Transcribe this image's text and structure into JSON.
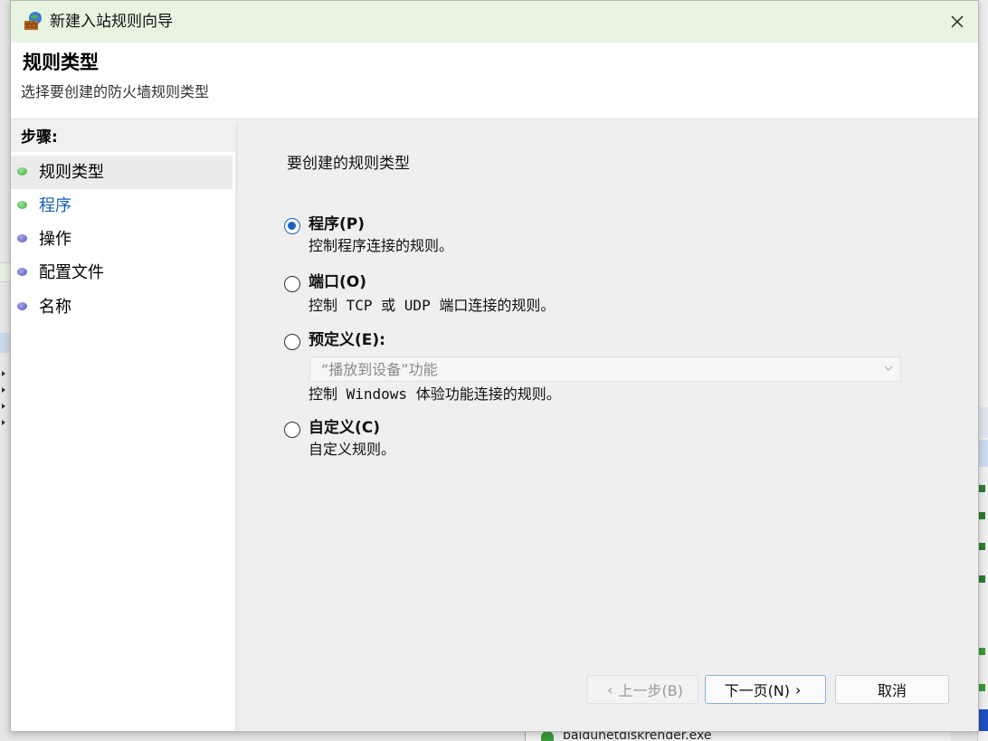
{
  "window": {
    "title": "新建入站规则向导"
  },
  "header": {
    "title": "规则类型",
    "subtitle": "选择要创建的防火墙规则类型"
  },
  "steps": {
    "header": "步骤:",
    "items": [
      {
        "label": "规则类型",
        "state": "active",
        "dot_color": "#3daa3d"
      },
      {
        "label": "程序",
        "state": "link",
        "dot_color": "#3daa3d"
      },
      {
        "label": "操作",
        "state": "normal",
        "dot_color": "#5050b8"
      },
      {
        "label": "配置文件",
        "state": "normal",
        "dot_color": "#5050b8"
      },
      {
        "label": "名称",
        "state": "normal",
        "dot_color": "#5050b8"
      }
    ]
  },
  "content": {
    "section_label": "要创建的规则类型",
    "options": [
      {
        "title": "程序(P)",
        "description": "控制程序连接的规则。",
        "checked": true
      },
      {
        "title": "端口(O)",
        "description": "控制 TCP 或 UDP 端口连接的规则。",
        "checked": false
      },
      {
        "title": "预定义(E):",
        "description": "控制 Windows 体验功能连接的规则。",
        "checked": false,
        "dropdown": {
          "selected": "“播放到设备”功能",
          "disabled": true
        }
      },
      {
        "title": "自定义(C)",
        "description": "自定义规则。",
        "checked": false
      }
    ]
  },
  "buttons": {
    "back": "上一步(B)",
    "next": "下一页(N)",
    "cancel": "取消"
  },
  "background": {
    "bottom_text": "baidunetdiskrender.exe"
  },
  "colors": {
    "titlebar": "#e6f4e1",
    "accent": "#1d5fbf",
    "link": "#1a5fb4"
  },
  "icons": {
    "app": "firewall-wall-globe-icon",
    "close": "close-icon",
    "back": "chevron-left-icon",
    "next": "chevron-right-icon",
    "dropdown": "chevron-down-icon"
  }
}
